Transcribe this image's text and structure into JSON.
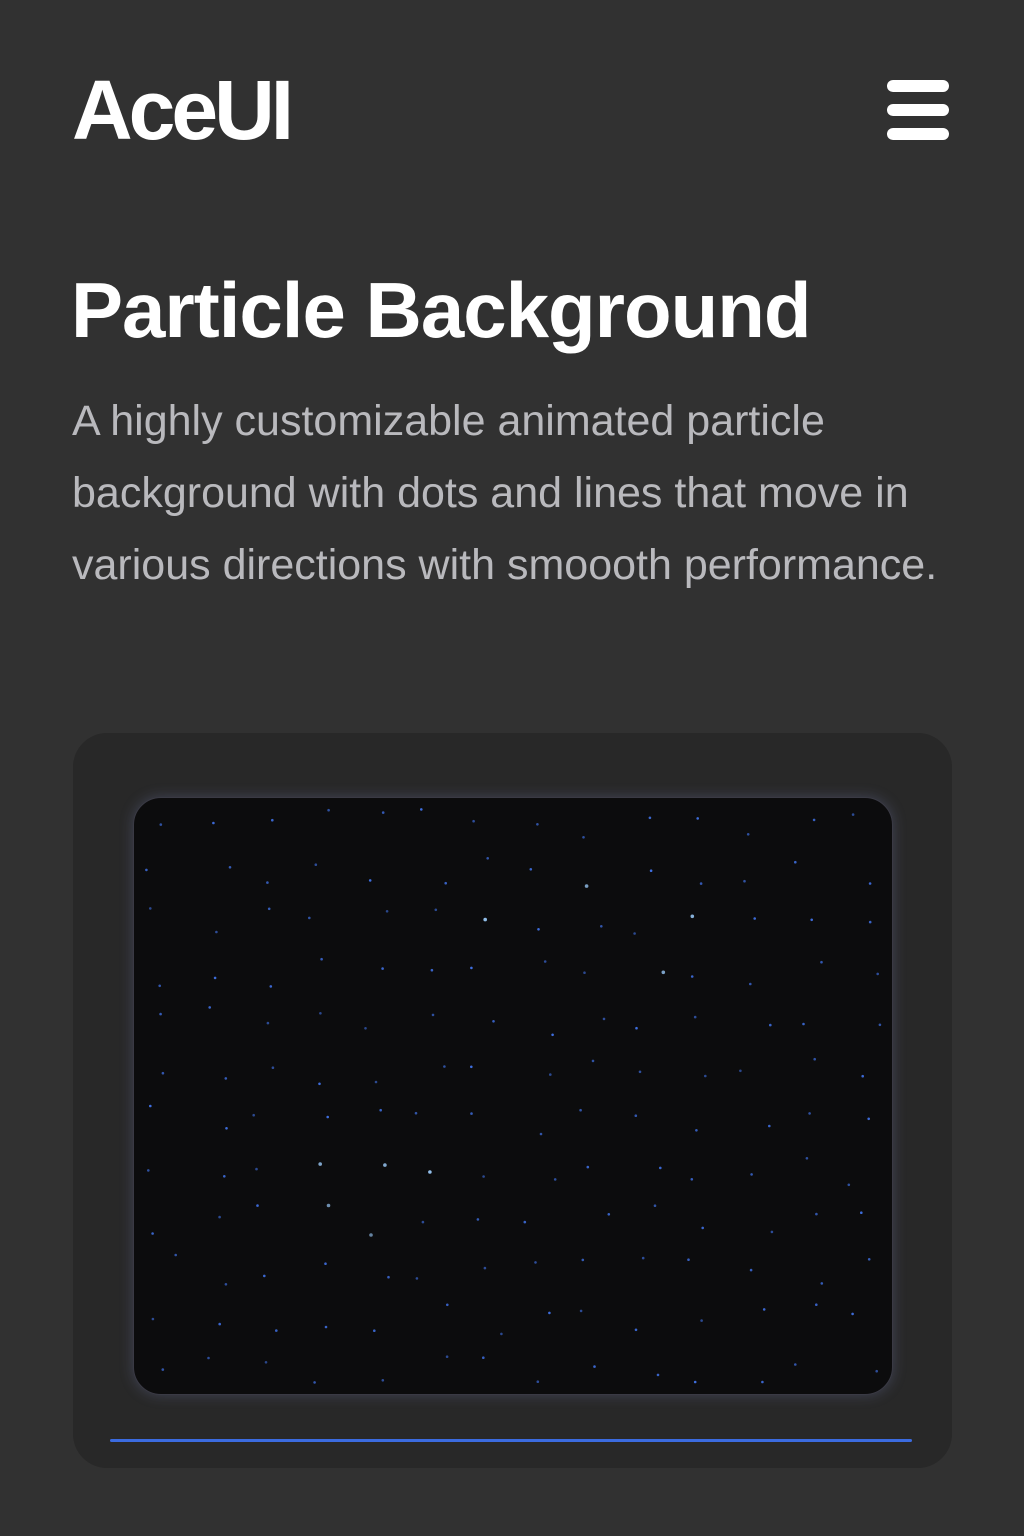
{
  "app": {
    "logo": "AceUI"
  },
  "header": {
    "menu_icon": "hamburger-menu-icon"
  },
  "main": {
    "title": "Particle Background",
    "description": "A highly customizable animated particle background with dots and lines that move in various directions with smoooth performance."
  },
  "preview": {
    "progress": 1.0
  },
  "colors": {
    "background": "#313131",
    "card": "#282828",
    "canvas": "#0c0c0d",
    "particle": "#3f6fe0",
    "particle_bright": "#9fd0ff",
    "accent": "#3b6be0",
    "text_primary": "#ffffff",
    "text_secondary": "#b9b9bd"
  }
}
